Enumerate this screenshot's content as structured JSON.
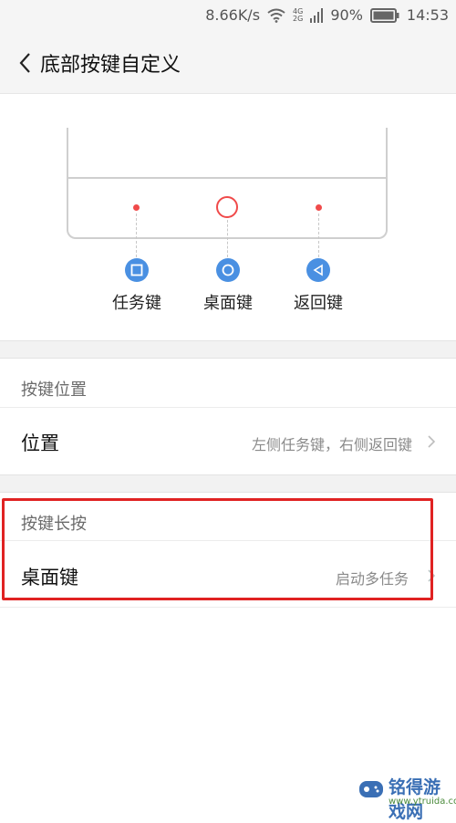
{
  "status_bar": {
    "speed": "8.66K/s",
    "network_4g": "4G",
    "network_2g": "2G",
    "battery": "90%",
    "time": "14:53"
  },
  "header": {
    "title": "底部按键自定义"
  },
  "illustration": {
    "keys": [
      {
        "label": "任务键",
        "icon": "square-icon"
      },
      {
        "label": "桌面键",
        "icon": "circle-icon"
      },
      {
        "label": "返回键",
        "icon": "triangle-left-icon"
      }
    ]
  },
  "sections": [
    {
      "title": "按键位置",
      "rows": [
        {
          "label": "位置",
          "value": "左侧任务键，右侧返回键"
        }
      ]
    },
    {
      "title": "按键长按",
      "rows": [
        {
          "label": "桌面键",
          "value": "启动多任务"
        }
      ]
    }
  ],
  "colors": {
    "accent_blue": "#4a90e2",
    "key_red": "#f04a4a",
    "highlight_red": "#e02222"
  },
  "watermark": {
    "brand": "铭得游戏网",
    "url": "www.ytruida.com"
  }
}
